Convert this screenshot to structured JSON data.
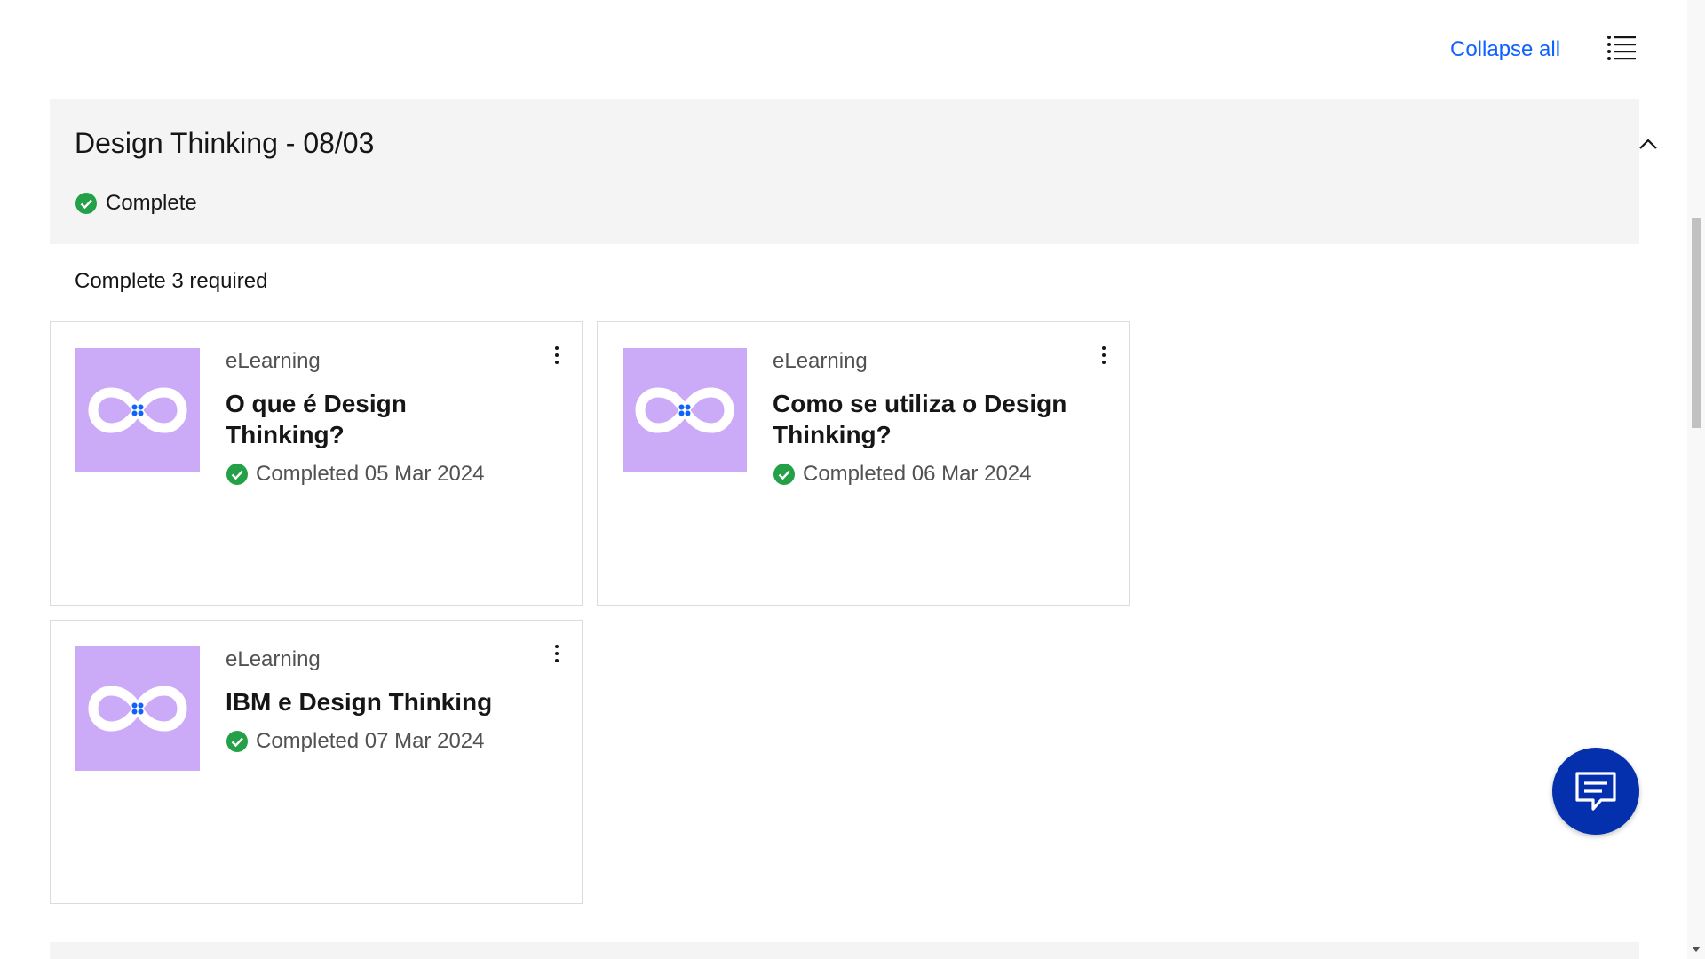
{
  "toolbar": {
    "collapse_all": "Collapse all",
    "list_icon": "list-view-icon"
  },
  "section": {
    "title": "Design Thinking - 08/03",
    "status": "Complete",
    "required_note": "Complete 3 required"
  },
  "cards": [
    {
      "type": "eLearning",
      "title": "O que é Design Thinking?",
      "status": "Completed 05 Mar 2024"
    },
    {
      "type": "eLearning",
      "title": "Como se utiliza o Design Thinking?",
      "status": "Completed 06 Mar 2024"
    },
    {
      "type": "eLearning",
      "title": "IBM e Design Thinking",
      "status": "Completed 07 Mar 2024"
    }
  ],
  "colors": {
    "link": "#0f62fe",
    "complete_green": "#24a148",
    "thumbnail_bg": "#cbaaf7",
    "chat_button": "#0530ad",
    "section_bg": "#f4f4f4"
  },
  "icons": {
    "check": "checkmark-filled-icon",
    "chevron": "chevron-up-icon",
    "overflow": "overflow-menu-vertical-icon",
    "chat": "chat-icon",
    "thumbnail": "infinity-logo-icon"
  }
}
